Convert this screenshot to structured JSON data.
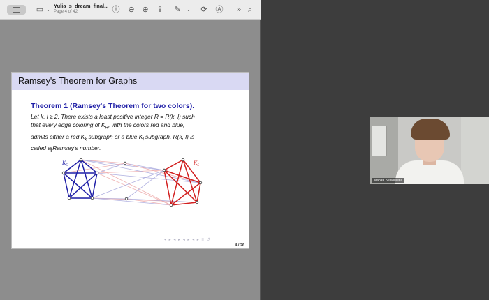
{
  "toolbar": {
    "doc_title": "Yulia_s_dream_final...",
    "page_info": "Page 4 of 42",
    "icons": [
      "sidebar-icon",
      "chevron-down-icon",
      "info-icon",
      "zoom-out-icon",
      "zoom-in-icon",
      "share-icon",
      "markup-icon",
      "chevron-down-icon",
      "rotate-icon",
      "annotate-icon",
      "more-icon",
      "search-icon"
    ]
  },
  "slide": {
    "title": "Ramsey's Theorem for Graphs",
    "theorem_heading": "Theorem 1 (Ramsey's Theorem for two colors).",
    "theorem_lines": [
      "Let k, l ≥ 2.  There exists a least positive integer R = R(k, l) such",
      "that every edge coloring of K",
      "admits either a red K",
      "called a Ramsey's number."
    ],
    "theorem_parts": {
      "line2_sub": "R",
      "line2_rest": ", with the colors red and blue,",
      "line3_sub_k": "k",
      "line3_mid": " subgraph or a blue K",
      "line3_sub_l": "l",
      "line3_rest": " subgraph.  R(k, l) is"
    },
    "graph_labels": {
      "left": "K",
      "left_sub": "5",
      "right": "K",
      "right_sub": "5"
    },
    "nav_icons": "◂ ▸ ◂ ▸ ◂ ▸ ◂ ▸ ≡ ↺",
    "page_number": "4 / 26",
    "colors": {
      "header": "#d9d9f3",
      "blue": "#1f1fa7",
      "red": "#d21f1f"
    }
  },
  "video": {
    "participant_name": "Мария Белышева"
  }
}
